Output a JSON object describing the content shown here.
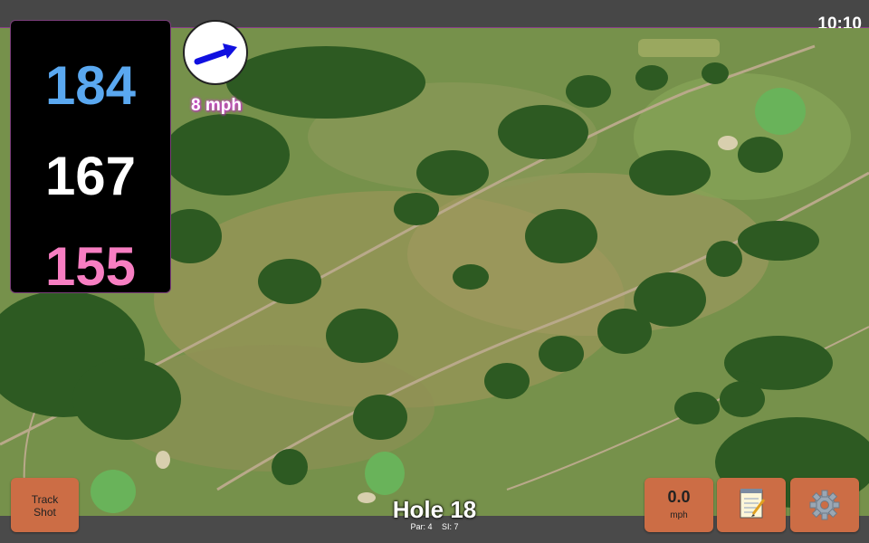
{
  "status_bar": {
    "time": "10:10"
  },
  "distances": {
    "back": "184",
    "middle": "167",
    "front": "155"
  },
  "wind": {
    "speed_text": "8 mph",
    "direction_icon": "arrow-icon"
  },
  "buttons": {
    "track_shot": {
      "line1": "Track",
      "line2": "Shot"
    },
    "wind": {
      "value": "0.0",
      "unit": "mph"
    },
    "notes": {
      "icon": "notepad-icon"
    },
    "settings": {
      "icon": "gear-icon"
    }
  },
  "hole": {
    "title": "Hole 18",
    "par": "Par: 4",
    "si": "SI: 7"
  },
  "colors": {
    "back_distance": "#5aa8f0",
    "middle_distance": "#ffffff",
    "front_distance": "#f77ec2",
    "button": "#cc6d45",
    "wind_text_glow": "#d24fd2"
  }
}
